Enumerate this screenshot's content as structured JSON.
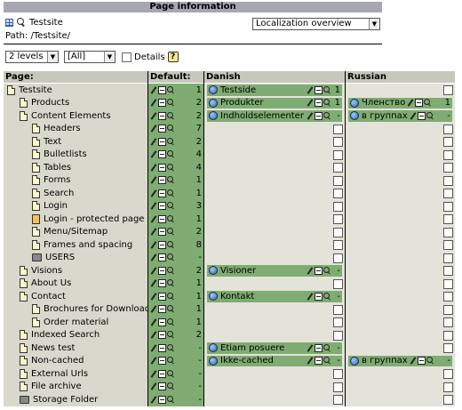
{
  "header": {
    "title": "Page information"
  },
  "site": {
    "name": "Testsite",
    "path_label": "Path: /Testsite/"
  },
  "view_select": {
    "value": "Localization overview"
  },
  "controls": {
    "levels": "2 levels",
    "filter": "[All]",
    "details_label": "Details"
  },
  "columns": {
    "page": "Page:",
    "default": "Default:",
    "danish": "Danish",
    "russian": "Russian"
  },
  "icons": {
    "page": "page-icon",
    "folder": "folder-icon",
    "lock": "lock-icon",
    "globe": "globe-icon",
    "edit": "pencil-icon",
    "new": "new-page-icon",
    "view": "magnifier-icon"
  },
  "rows": [
    {
      "title": "Testsite",
      "indent": 0,
      "icon": "page",
      "default_count": "1",
      "danish": "Testside",
      "danish_count": "1",
      "russian": "",
      "russian_count": ""
    },
    {
      "title": "Products",
      "indent": 1,
      "icon": "page",
      "default_count": "2",
      "danish": "Produkter",
      "danish_count": "1",
      "russian": "Членство",
      "russian_count": "1"
    },
    {
      "title": "Content Elements",
      "indent": 1,
      "icon": "page",
      "default_count": "2",
      "danish": "Indholdselementer",
      "danish_count": "-",
      "russian": "в группах",
      "russian_count": "-"
    },
    {
      "title": "Headers",
      "indent": 2,
      "icon": "page",
      "default_count": "7",
      "danish": "",
      "danish_count": "",
      "russian": "",
      "russian_count": ""
    },
    {
      "title": "Text",
      "indent": 2,
      "icon": "page",
      "default_count": "2",
      "danish": "",
      "danish_count": "",
      "russian": "",
      "russian_count": ""
    },
    {
      "title": "Bulletlists",
      "indent": 2,
      "icon": "page",
      "default_count": "4",
      "danish": "",
      "danish_count": "",
      "russian": "",
      "russian_count": ""
    },
    {
      "title": "Tables",
      "indent": 2,
      "icon": "page",
      "default_count": "4",
      "danish": "",
      "danish_count": "",
      "russian": "",
      "russian_count": ""
    },
    {
      "title": "Forms",
      "indent": 2,
      "icon": "page",
      "default_count": "1",
      "danish": "",
      "danish_count": "",
      "russian": "",
      "russian_count": ""
    },
    {
      "title": "Search",
      "indent": 2,
      "icon": "page",
      "default_count": "1",
      "danish": "",
      "danish_count": "",
      "russian": "",
      "russian_count": ""
    },
    {
      "title": "Login",
      "indent": 2,
      "icon": "page",
      "default_count": "3",
      "danish": "",
      "danish_count": "",
      "russian": "",
      "russian_count": ""
    },
    {
      "title": "Login - protected page",
      "indent": 2,
      "icon": "lock",
      "default_count": "1",
      "danish": "",
      "danish_count": "",
      "russian": "",
      "russian_count": ""
    },
    {
      "title": "Menu/Sitemap",
      "indent": 2,
      "icon": "page",
      "default_count": "2",
      "danish": "",
      "danish_count": "",
      "russian": "",
      "russian_count": ""
    },
    {
      "title": "Frames and spacing",
      "indent": 2,
      "icon": "page",
      "default_count": "8",
      "danish": "",
      "danish_count": "",
      "russian": "",
      "russian_count": ""
    },
    {
      "title": "USERS",
      "indent": 2,
      "icon": "folder",
      "default_count": "-",
      "danish": "",
      "danish_count": "",
      "russian": "",
      "russian_count": ""
    },
    {
      "title": "Visions",
      "indent": 1,
      "icon": "page",
      "default_count": "2",
      "danish": "Visioner",
      "danish_count": "-",
      "russian": "",
      "russian_count": ""
    },
    {
      "title": "About Us",
      "indent": 1,
      "icon": "page",
      "default_count": "1",
      "danish": "",
      "danish_count": "",
      "russian": "",
      "russian_count": ""
    },
    {
      "title": "Contact",
      "indent": 1,
      "icon": "page",
      "default_count": "1",
      "danish": "Kontakt",
      "danish_count": "-",
      "russian": "",
      "russian_count": ""
    },
    {
      "title": "Brochures for Download",
      "indent": 2,
      "icon": "page",
      "default_count": "1",
      "danish": "",
      "danish_count": "",
      "russian": "",
      "russian_count": ""
    },
    {
      "title": "Order material",
      "indent": 2,
      "icon": "page",
      "default_count": "1",
      "danish": "",
      "danish_count": "",
      "russian": "",
      "russian_count": ""
    },
    {
      "title": "Indexed Search",
      "indent": 1,
      "icon": "page",
      "default_count": "2",
      "danish": "",
      "danish_count": "",
      "russian": "",
      "russian_count": ""
    },
    {
      "title": "News test",
      "indent": 1,
      "icon": "page",
      "default_count": "-",
      "danish": "Etiam posuere",
      "danish_count": "-",
      "russian": "",
      "russian_count": ""
    },
    {
      "title": "Non-cached",
      "indent": 1,
      "icon": "page",
      "default_count": "-",
      "danish": "Ikke-cached",
      "danish_count": "-",
      "russian": "в группах",
      "russian_count": "-"
    },
    {
      "title": "External Urls",
      "indent": 1,
      "icon": "page",
      "default_count": "-",
      "danish": "",
      "danish_count": "",
      "russian": "",
      "russian_count": ""
    },
    {
      "title": "File archive",
      "indent": 1,
      "icon": "page",
      "default_count": "-",
      "danish": "",
      "danish_count": "",
      "russian": "",
      "russian_count": ""
    },
    {
      "title": "Storage Folder",
      "indent": 1,
      "icon": "folder",
      "default_count": "-",
      "danish": "",
      "danish_count": "",
      "russian": "",
      "russian_count": ""
    }
  ],
  "colors": {
    "header_bar": "#a6a7b0",
    "translated": "#7fac72",
    "page_col": "#d9d8cc",
    "empty_col": "#e4e3d9"
  }
}
